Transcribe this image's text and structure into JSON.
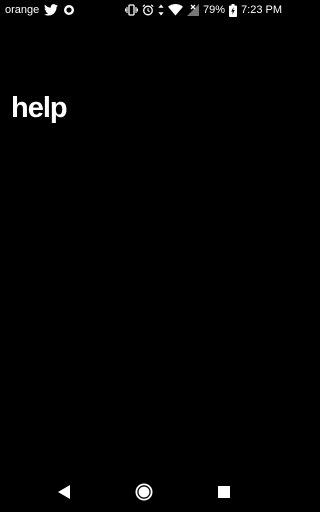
{
  "status_bar": {
    "carrier": "orange",
    "battery": "79%",
    "time": "7:23 PM",
    "left_icons": [
      "twitter-icon",
      "circle-notification-icon"
    ],
    "right_icons": [
      "vibrate-icon",
      "alarm-icon",
      "data-arrows-icon",
      "wifi-icon",
      "signal-no-sim-icon",
      "battery-charging-icon"
    ]
  },
  "main": {
    "title": "help"
  },
  "nav_bar": {
    "buttons": [
      "back-icon",
      "home-icon",
      "recents-icon"
    ]
  },
  "colors": {
    "background": "#000000",
    "foreground": "#ffffff"
  }
}
